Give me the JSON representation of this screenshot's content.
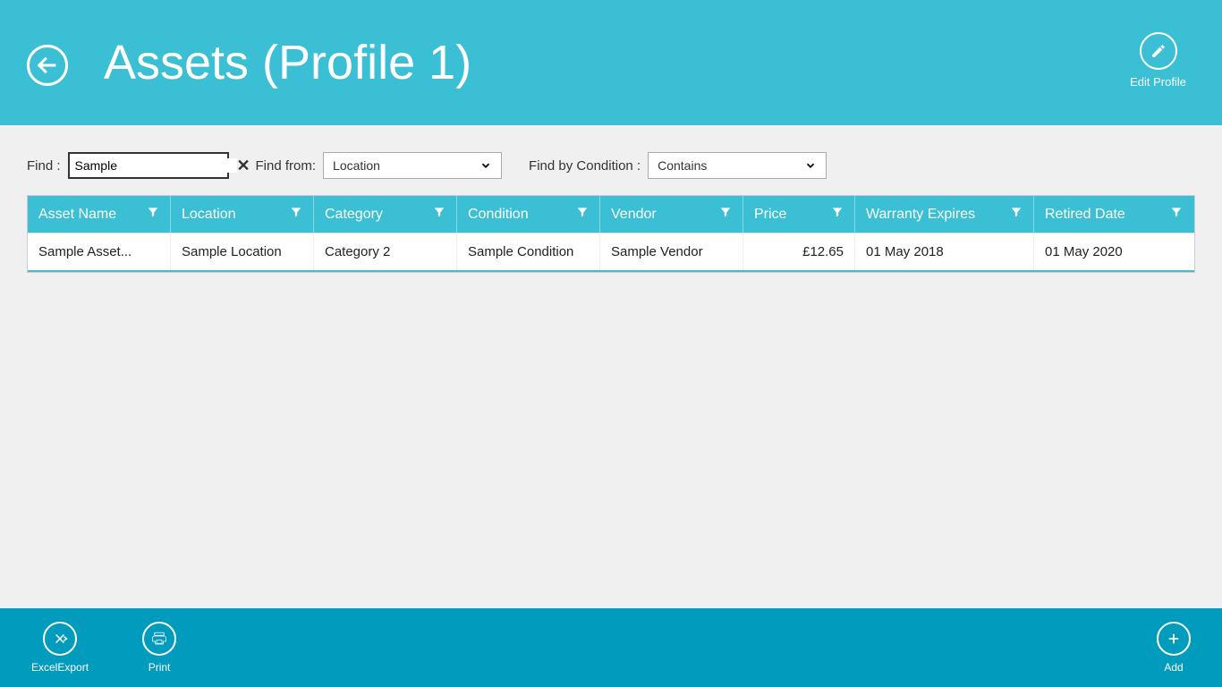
{
  "header": {
    "title": "Assets (Profile 1)",
    "edit_profile_label": "Edit Profile"
  },
  "filters": {
    "find_label": "Find :",
    "find_value": "Sample",
    "find_from_label": "Find from:",
    "find_from_value": "Location",
    "find_cond_label": "Find by Condition :",
    "find_cond_value": "Contains"
  },
  "columns": {
    "c1": "Asset Name",
    "c2": "Location",
    "c3": "Category",
    "c4": "Condition",
    "c5": "Vendor",
    "c6": "Price",
    "c7": "Warranty Expires",
    "c8": "Retired Date"
  },
  "rows": [
    {
      "asset_name": "Sample Asset...",
      "location": "Sample Location",
      "category": "Category 2",
      "condition": "Sample Condition",
      "vendor": "Sample Vendor",
      "price": "£12.65",
      "warranty_expires": "01 May 2018",
      "retired_date": "01 May 2020"
    }
  ],
  "bottombar": {
    "excel_label": "ExcelExport",
    "print_label": "Print",
    "add_label": "Add"
  }
}
